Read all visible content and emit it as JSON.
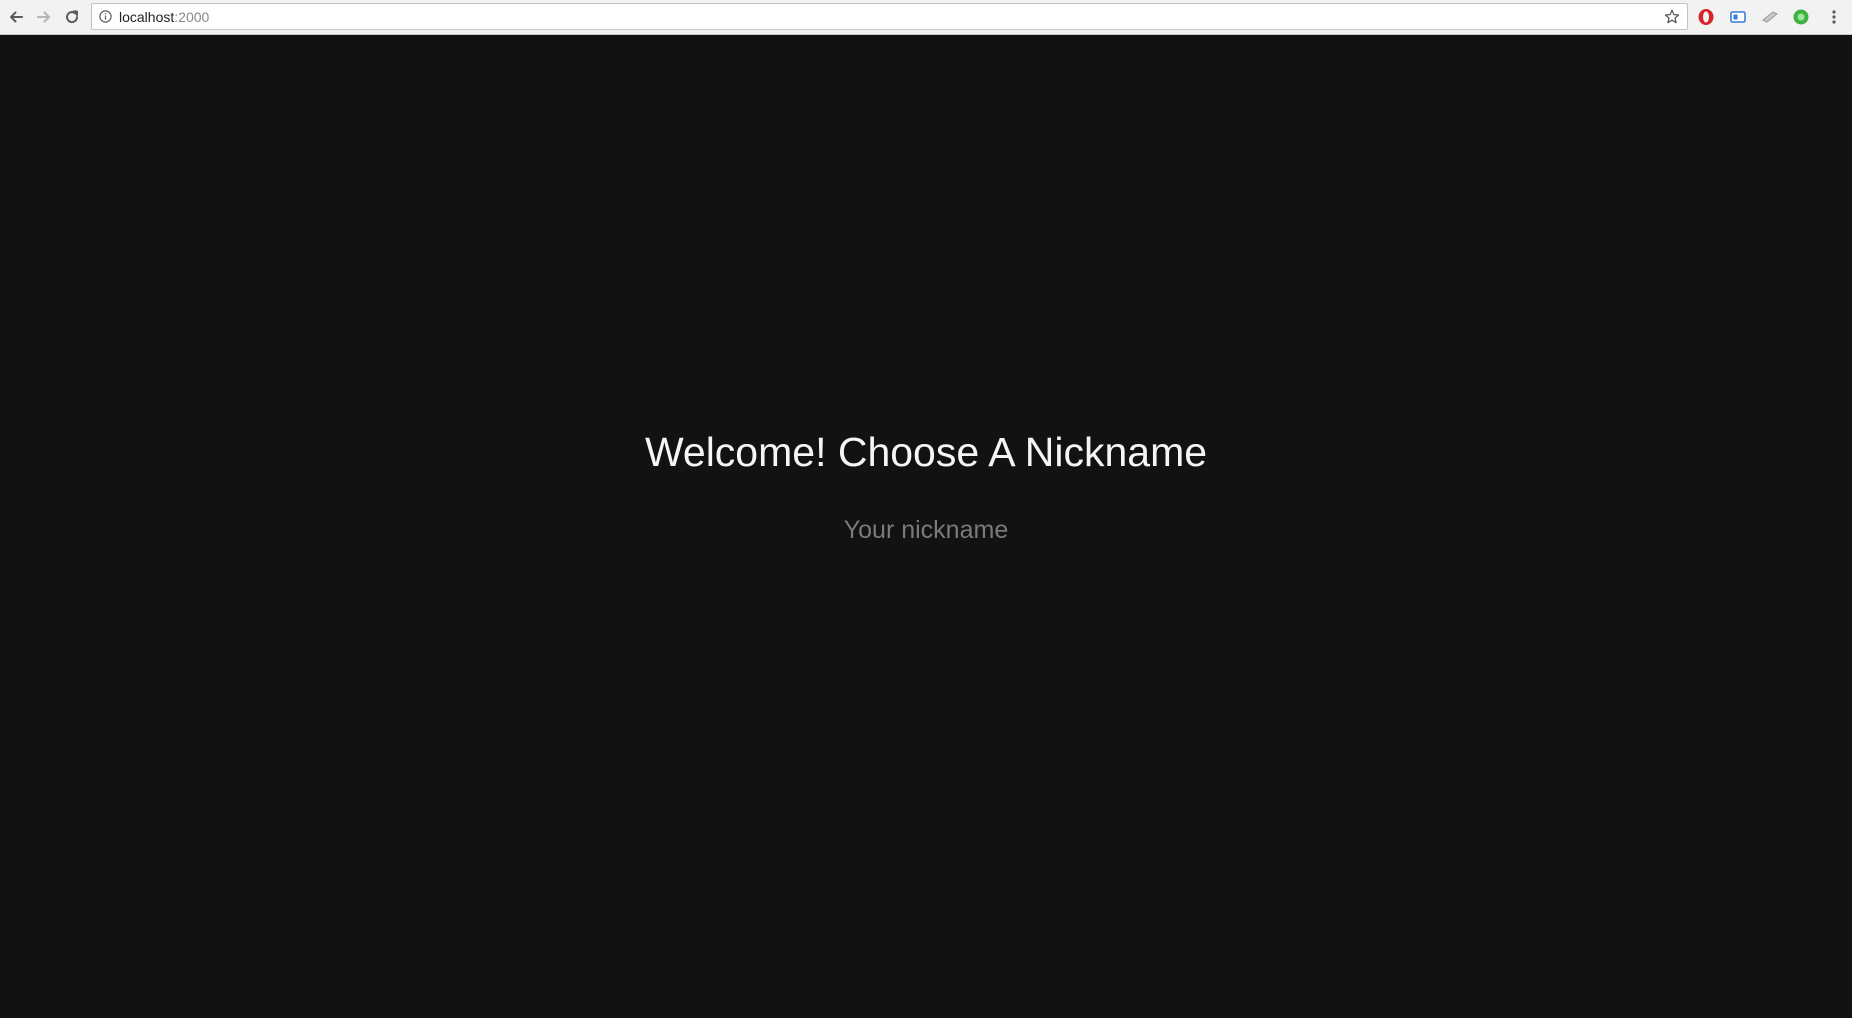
{
  "browser": {
    "url_host": "localhost",
    "url_port": ":2000",
    "icons": {
      "back": "back-arrow-icon",
      "forward": "forward-arrow-icon",
      "reload": "reload-icon",
      "info": "info-icon",
      "bookmark": "star-icon",
      "menu": "kebab-menu-icon"
    },
    "extensions": [
      "opera-extension-icon",
      "blue-tab-extension-icon",
      "grey-extension-icon",
      "green-extension-icon"
    ]
  },
  "page": {
    "title": "Welcome! Choose A Nickname",
    "nickname_placeholder": "Your nickname",
    "nickname_value": ""
  },
  "colors": {
    "page_background": "#121212",
    "title_text": "#f5f5f5",
    "placeholder_text": "#7a7a7a",
    "toolbar_background": "#f2f2f2"
  }
}
